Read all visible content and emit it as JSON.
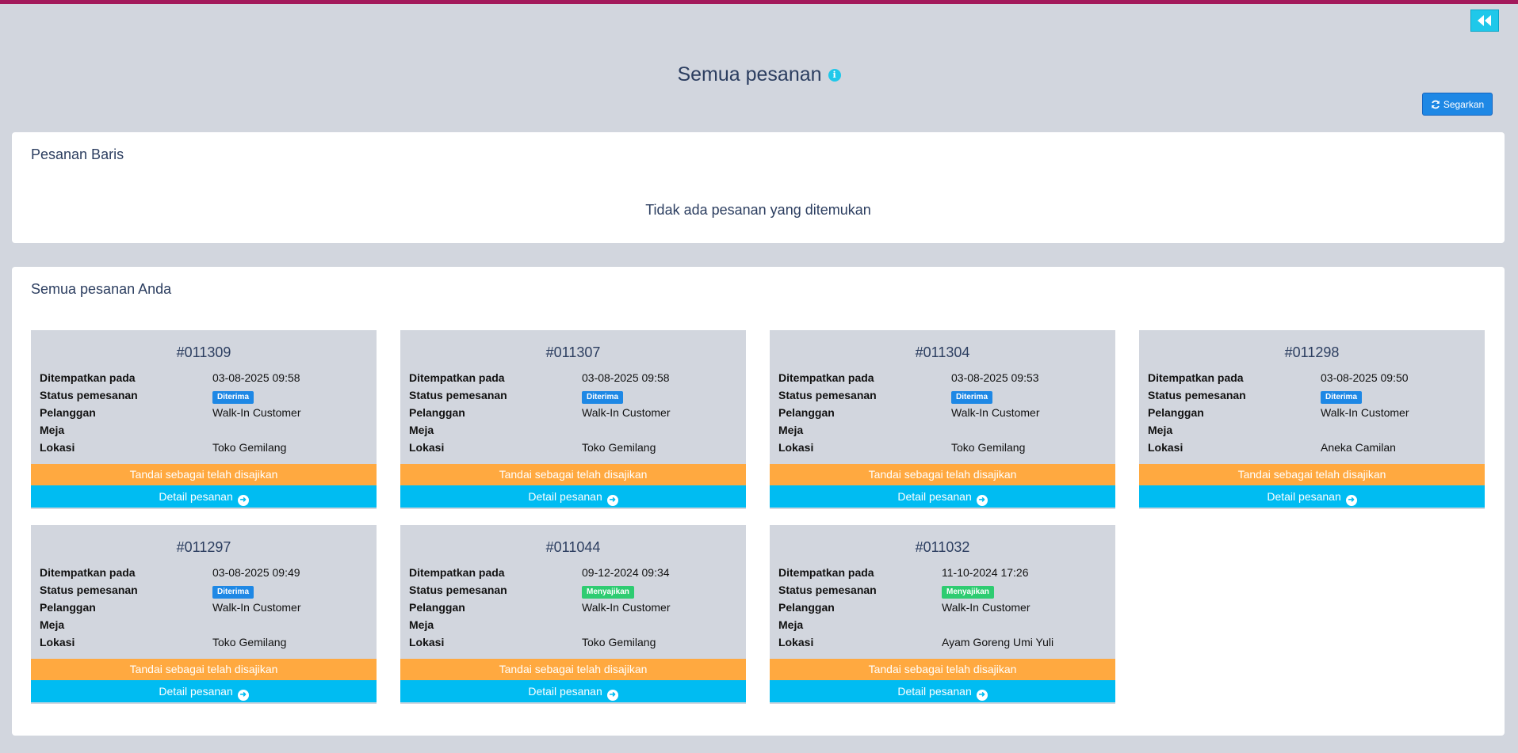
{
  "header": {
    "title": "Semua pesanan",
    "refresh_label": "Segarkan"
  },
  "panel_line": {
    "title": "Pesanan Baris",
    "empty_message": "Tidak ada pesanan yang ditemukan"
  },
  "panel_all": {
    "title": "Semua pesanan Anda"
  },
  "labels": {
    "placed": "Ditempatkan pada",
    "status": "Status pemesanan",
    "customer": "Pelanggan",
    "table": "Meja",
    "location": "Lokasi",
    "serve_button": "Tandai sebagai telah disajikan",
    "detail_button": "Detail pesanan"
  },
  "colors": {
    "accent_bar": "#a3195b",
    "status_received": "#1e88e5",
    "status_serving": "#2ecc71",
    "serve_button": "#ffa940",
    "detail_button": "#00bcf2"
  },
  "orders": [
    {
      "id": "#011309",
      "placed": "03-08-2025 09:58",
      "status": "Diterima",
      "status_color": "blue",
      "customer": "Walk-In Customer",
      "table": "",
      "location": "Toko Gemilang"
    },
    {
      "id": "#011307",
      "placed": "03-08-2025 09:58",
      "status": "Diterima",
      "status_color": "blue",
      "customer": "Walk-In Customer",
      "table": "",
      "location": "Toko Gemilang"
    },
    {
      "id": "#011304",
      "placed": "03-08-2025 09:53",
      "status": "Diterima",
      "status_color": "blue",
      "customer": "Walk-In Customer",
      "table": "",
      "location": "Toko Gemilang"
    },
    {
      "id": "#011298",
      "placed": "03-08-2025 09:50",
      "status": "Diterima",
      "status_color": "blue",
      "customer": "Walk-In Customer",
      "table": "",
      "location": "Aneka Camilan"
    },
    {
      "id": "#011297",
      "placed": "03-08-2025 09:49",
      "status": "Diterima",
      "status_color": "blue",
      "customer": "Walk-In Customer",
      "table": "",
      "location": "Toko Gemilang"
    },
    {
      "id": "#011044",
      "placed": "09-12-2024 09:34",
      "status": "Menyajikan",
      "status_color": "green",
      "customer": "Walk-In Customer",
      "table": "",
      "location": "Toko Gemilang"
    },
    {
      "id": "#011032",
      "placed": "11-10-2024 17:26",
      "status": "Menyajikan",
      "status_color": "green",
      "customer": "Walk-In Customer",
      "table": "",
      "location": "Ayam Goreng Umi Yuli"
    }
  ]
}
